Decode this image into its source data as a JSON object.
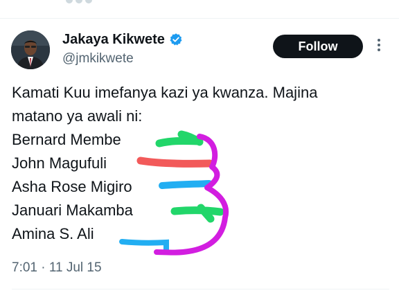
{
  "tweet": {
    "author": {
      "display_name": "Jakaya Kikwete",
      "handle": "@jmkikwete",
      "verified": true,
      "verified_color": "#1d9bf0"
    },
    "follow_label": "Follow",
    "text_intro_line1": "Kamati Kuu imefanya kazi ya kwanza. Majina",
    "text_intro_line2": "matano ya awali ni:",
    "names": [
      "Bernard Membe",
      "John Magufuli",
      "Asha Rose Migiro",
      "Januari Makamba",
      "Amina S. Ali"
    ],
    "timestamp": "7:01 · 11 Jul 15"
  },
  "colors": {
    "scribble_green": "#22d66a",
    "scribble_red": "#f25a5a",
    "scribble_blue": "#22aef2",
    "scribble_magenta": "#d21ee0"
  },
  "icons": [
    "verified-badge-icon",
    "more-options-icon"
  ]
}
